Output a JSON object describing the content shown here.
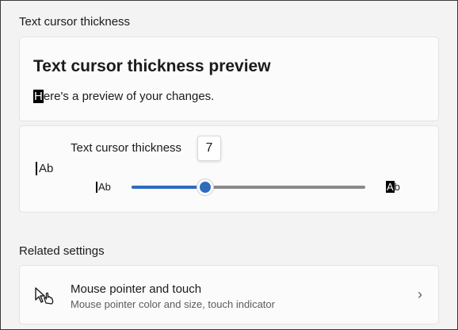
{
  "section": {
    "title": "Text cursor thickness"
  },
  "preview": {
    "heading": "Text cursor thickness preview",
    "text_first_char": "H",
    "text_rest": "ere's a preview of your changes."
  },
  "slider": {
    "label": "Text cursor thickness",
    "value": "7",
    "min": 1,
    "max": 20,
    "current": 7,
    "icon_main": "Ab",
    "min_label": "Ab",
    "max_label_highlight": "A",
    "max_label_rest": "b",
    "accent": "#2f6cc0"
  },
  "related": {
    "title": "Related settings",
    "items": [
      {
        "title": "Mouse pointer and touch",
        "subtitle": "Mouse pointer color and size, touch indicator",
        "icon": "mouse-pointer-touch-icon"
      }
    ]
  }
}
